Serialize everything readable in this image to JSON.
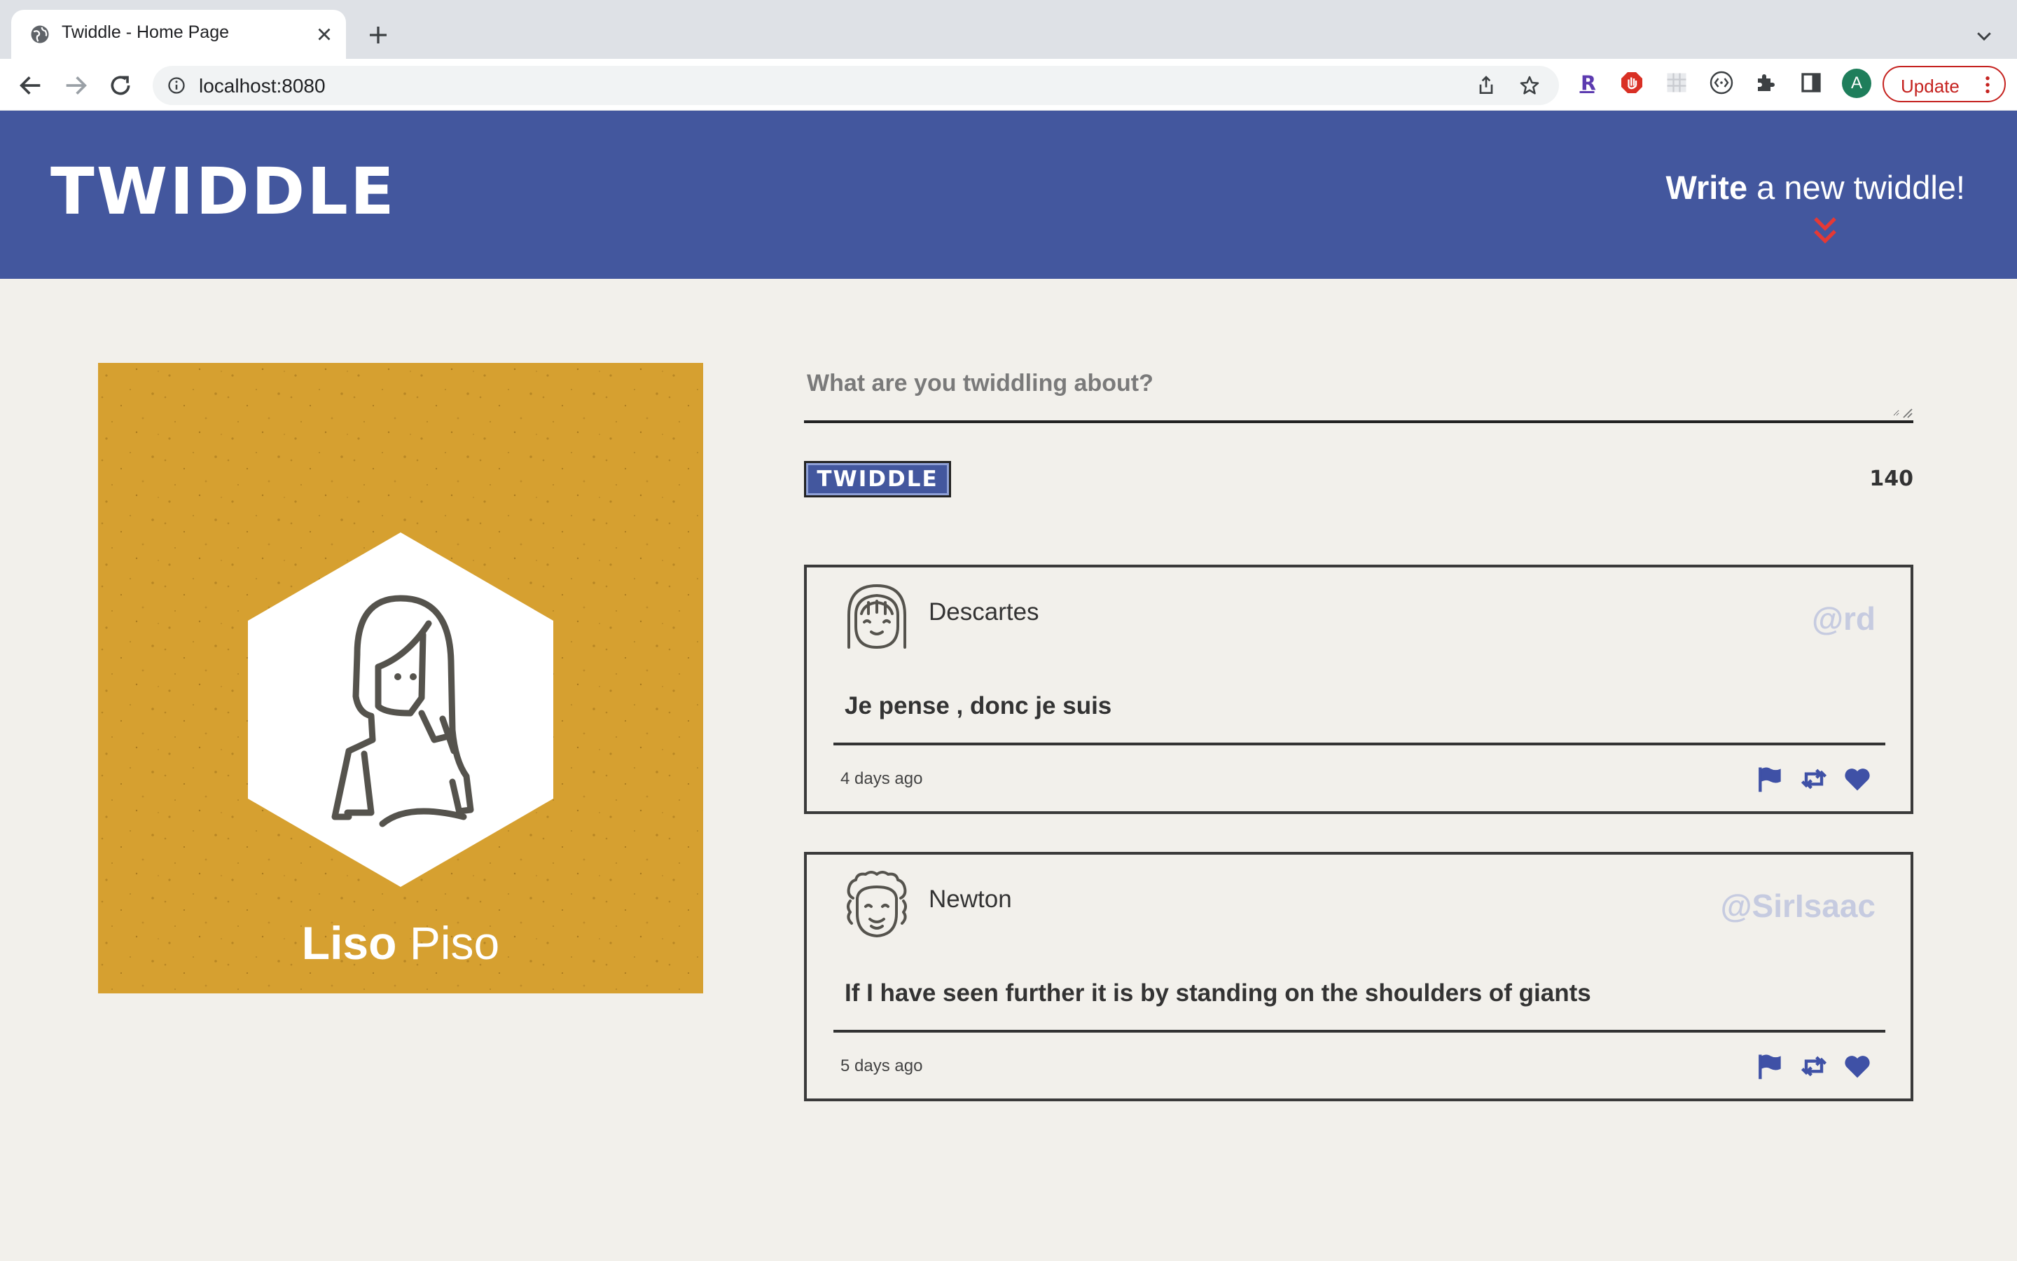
{
  "browser": {
    "tab_title": "Twiddle - Home Page",
    "url": "localhost:8080",
    "profile_initial": "A",
    "update_label": "Update"
  },
  "header": {
    "logo": "TWIDDLE",
    "write_bold": "Write",
    "write_rest": " a new twiddle!"
  },
  "profile": {
    "first_name": "Liso",
    "last_name": "Piso"
  },
  "composer": {
    "placeholder": "What are you twiddling about?",
    "button_label": "TWIDDLE",
    "char_count": "140"
  },
  "tweets": [
    {
      "name": "Descartes",
      "handle": "@rd",
      "text": "Je pense , donc je suis",
      "time": "4 days ago"
    },
    {
      "name": "Newton",
      "handle": "@SirIsaac",
      "text": "If I have seen further it is by standing on the shoulders of giants",
      "time": "5 days ago"
    }
  ],
  "colors": {
    "header_bg": "#43579e",
    "page_bg": "#f2f0eb",
    "card_bg": "#d6a030",
    "accent_red": "#e53935",
    "action_blue": "#3f51a6"
  }
}
